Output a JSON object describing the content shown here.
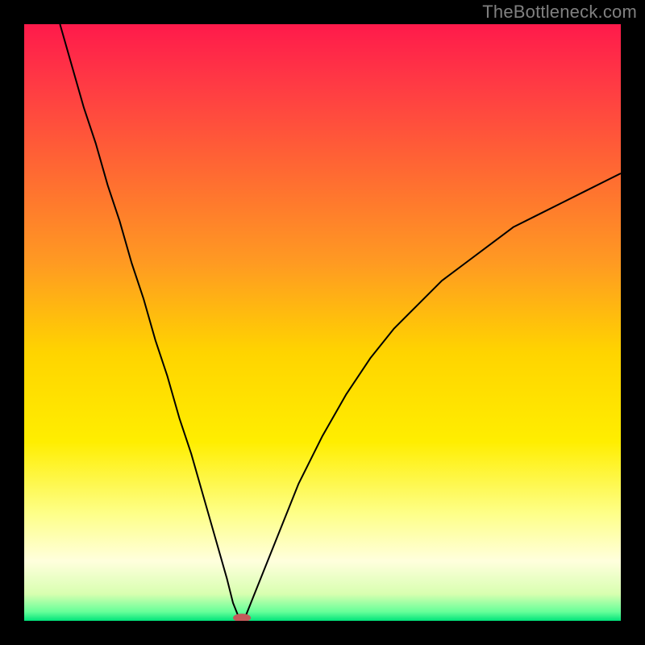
{
  "watermark": "TheBottleneck.com",
  "chart_data": {
    "type": "line",
    "title": "",
    "xlabel": "",
    "ylabel": "",
    "xlim": [
      0,
      100
    ],
    "ylim": [
      0,
      100
    ],
    "background_gradient": [
      {
        "pos": 0.0,
        "color": "#ff1a4b"
      },
      {
        "pos": 0.1,
        "color": "#ff3a44"
      },
      {
        "pos": 0.25,
        "color": "#ff6a32"
      },
      {
        "pos": 0.4,
        "color": "#ff9a22"
      },
      {
        "pos": 0.55,
        "color": "#ffd400"
      },
      {
        "pos": 0.7,
        "color": "#ffee00"
      },
      {
        "pos": 0.82,
        "color": "#feff88"
      },
      {
        "pos": 0.9,
        "color": "#ffffdd"
      },
      {
        "pos": 0.955,
        "color": "#d8ffb0"
      },
      {
        "pos": 0.985,
        "color": "#66ff99"
      },
      {
        "pos": 1.0,
        "color": "#00e37a"
      }
    ],
    "series": [
      {
        "name": "bottleneck-curve",
        "stroke": "#000000",
        "stroke_width": 2,
        "x": [
          6,
          8,
          10,
          12,
          14,
          16,
          18,
          20,
          22,
          24,
          26,
          28,
          30,
          32,
          34,
          35,
          36,
          37,
          38,
          40,
          42,
          44,
          46,
          48,
          50,
          54,
          58,
          62,
          66,
          70,
          74,
          78,
          82,
          86,
          90,
          94,
          98,
          100
        ],
        "y": [
          100,
          93,
          86,
          80,
          73,
          67,
          60,
          54,
          47,
          41,
          34,
          28,
          21,
          14,
          7,
          3,
          0.5,
          0.5,
          3,
          8,
          13,
          18,
          23,
          27,
          31,
          38,
          44,
          49,
          53,
          57,
          60,
          63,
          66,
          68,
          70,
          72,
          74,
          75
        ]
      }
    ],
    "marker": {
      "x": 36.5,
      "y": 0.5,
      "rx": 1.5,
      "ry": 0.7,
      "fill": "#c45a5a"
    }
  }
}
